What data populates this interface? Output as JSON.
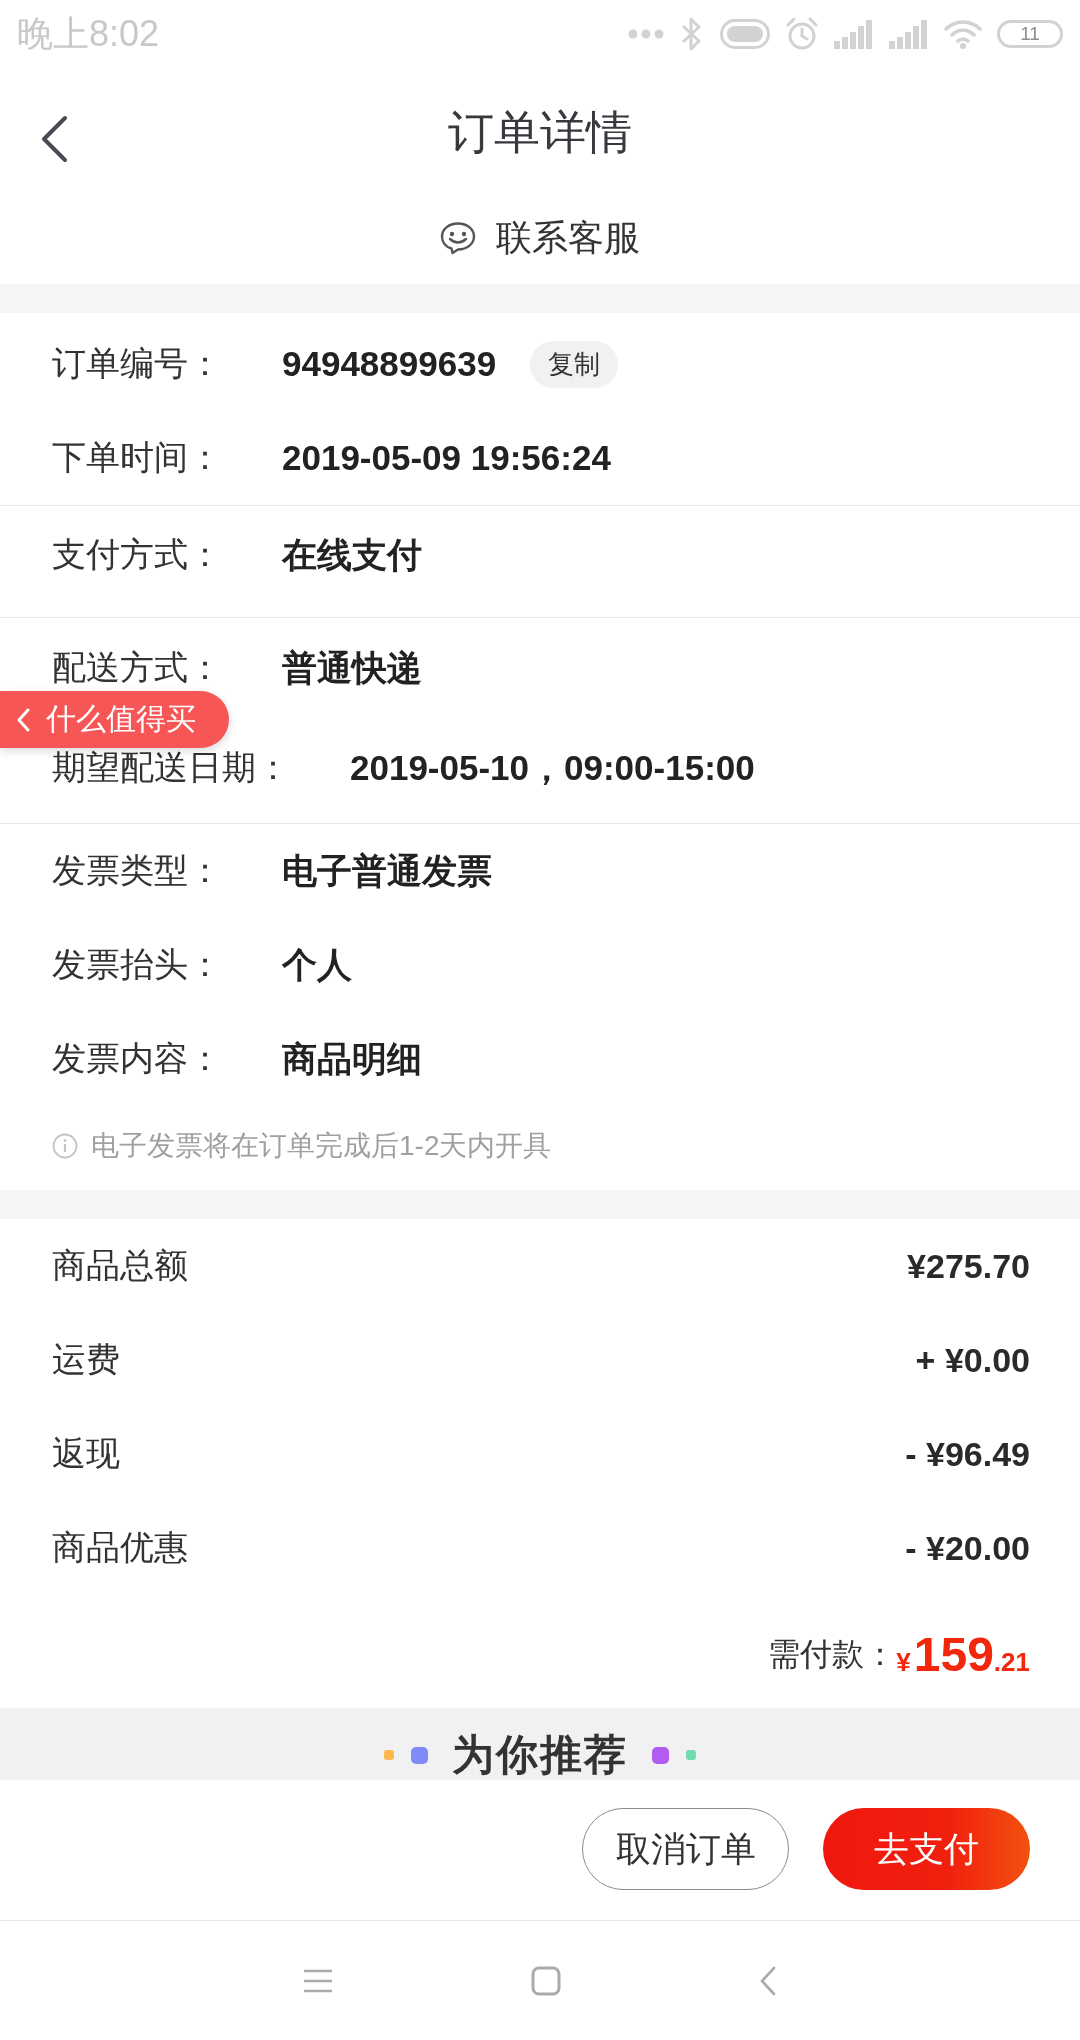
{
  "status_bar": {
    "time": "晚上8:02",
    "battery": "11"
  },
  "header": {
    "title": "订单详情",
    "contact": "联系客服"
  },
  "order_info": {
    "groups": [
      {
        "rows": [
          {
            "label": "订单编号：",
            "value": "94948899639",
            "button": "复制"
          },
          {
            "label": "下单时间：",
            "value": "2019-05-09 19:56:24"
          }
        ]
      },
      {
        "rows": [
          {
            "label": "支付方式：",
            "value": "在线支付"
          }
        ]
      },
      {
        "rows": [
          {
            "label": "配送方式：",
            "value": "普通快递"
          },
          {
            "label": "期望配送日期：",
            "value": "2019-05-10，09:00-15:00"
          }
        ]
      },
      {
        "rows": [
          {
            "label": "发票类型：",
            "value": "电子普通发票"
          },
          {
            "label": "发票抬头：",
            "value": "个人"
          },
          {
            "label": "发票内容：",
            "value": "商品明细"
          }
        ],
        "note": "电子发票将在订单完成后1-2天内开具"
      }
    ]
  },
  "floating_button": {
    "label": "什么值得买"
  },
  "prices": [
    {
      "label": "商品总额",
      "value": "¥275.70"
    },
    {
      "label": "运费",
      "value": "+ ¥0.00"
    },
    {
      "label": "返现",
      "value": "- ¥96.49"
    },
    {
      "label": "商品优惠",
      "value": "- ¥20.00"
    }
  ],
  "total": {
    "label": "需付款：",
    "currency": "¥",
    "integer": "159",
    "decimal": ".21"
  },
  "recommend": {
    "title": "为你推荐"
  },
  "actions": [
    {
      "label": "取消订单",
      "kind": "outline"
    },
    {
      "label": "去支付",
      "kind": "primary"
    }
  ]
}
